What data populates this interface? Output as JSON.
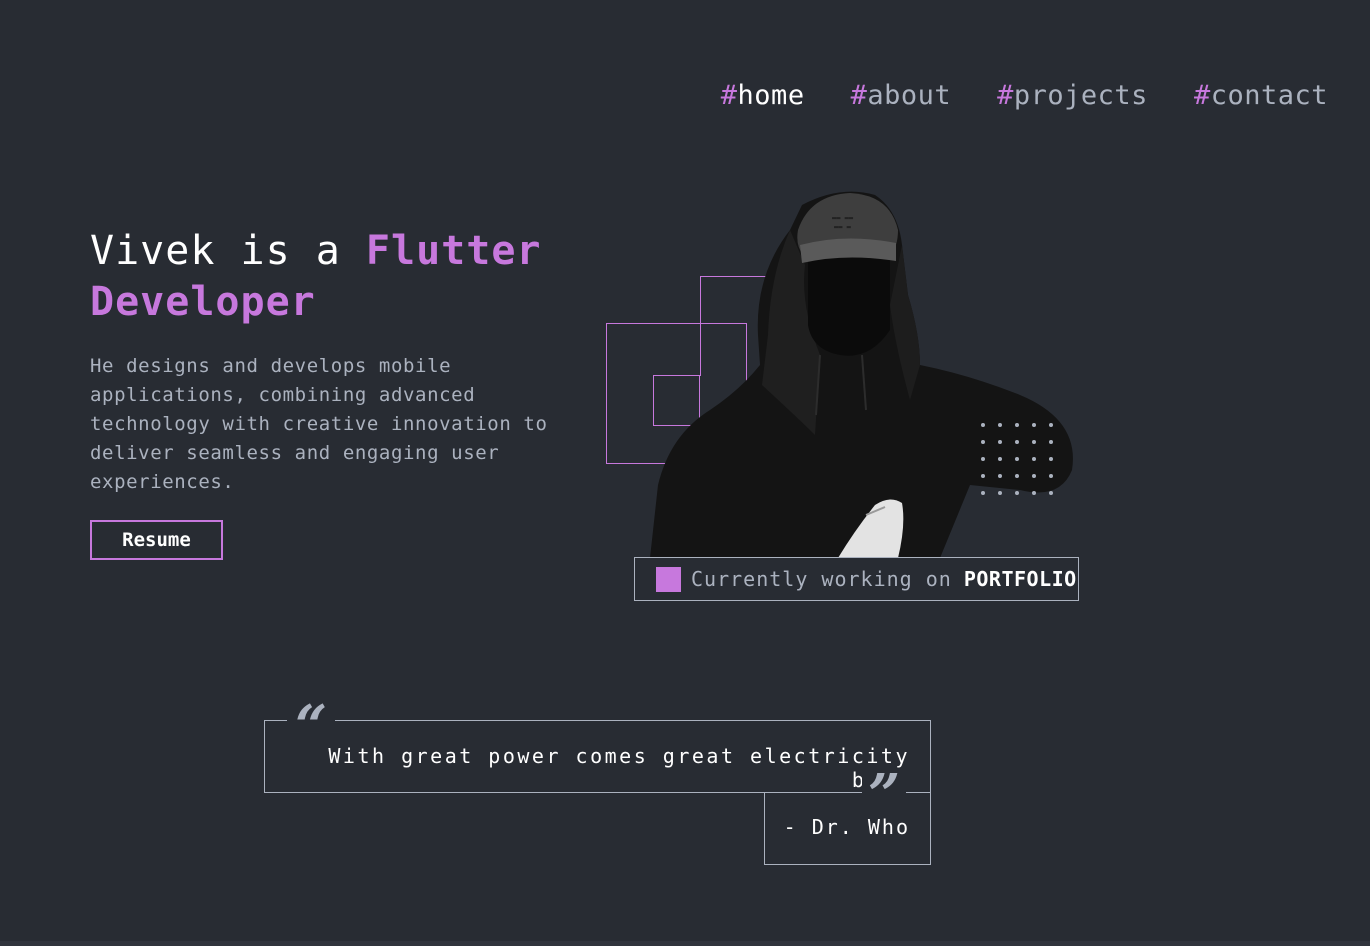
{
  "nav": {
    "items": [
      {
        "hash": "#",
        "label": "home"
      },
      {
        "hash": "#",
        "label": "about"
      },
      {
        "hash": "#",
        "label": "projects"
      },
      {
        "hash": "#",
        "label": "contact"
      }
    ]
  },
  "hero": {
    "title_plain": "Vivek is a ",
    "title_accent_1": "Flutter",
    "title_accent_2": "Developer",
    "description": "He designs and develops mobile applications, combining advanced technology with creative innovation to deliver seamless and engaging user experiences.",
    "resume_label": "Resume"
  },
  "status": {
    "text": "Currently working on",
    "project": "PORTFOLIO"
  },
  "quote": {
    "text": "With great power comes great electricity bill",
    "author": "- Dr. Who",
    "open_mark": "“",
    "close_mark": "”"
  },
  "colors": {
    "background": "#282c33",
    "accent": "#c778dd",
    "text": "#abb2bf",
    "white": "#ffffff"
  }
}
